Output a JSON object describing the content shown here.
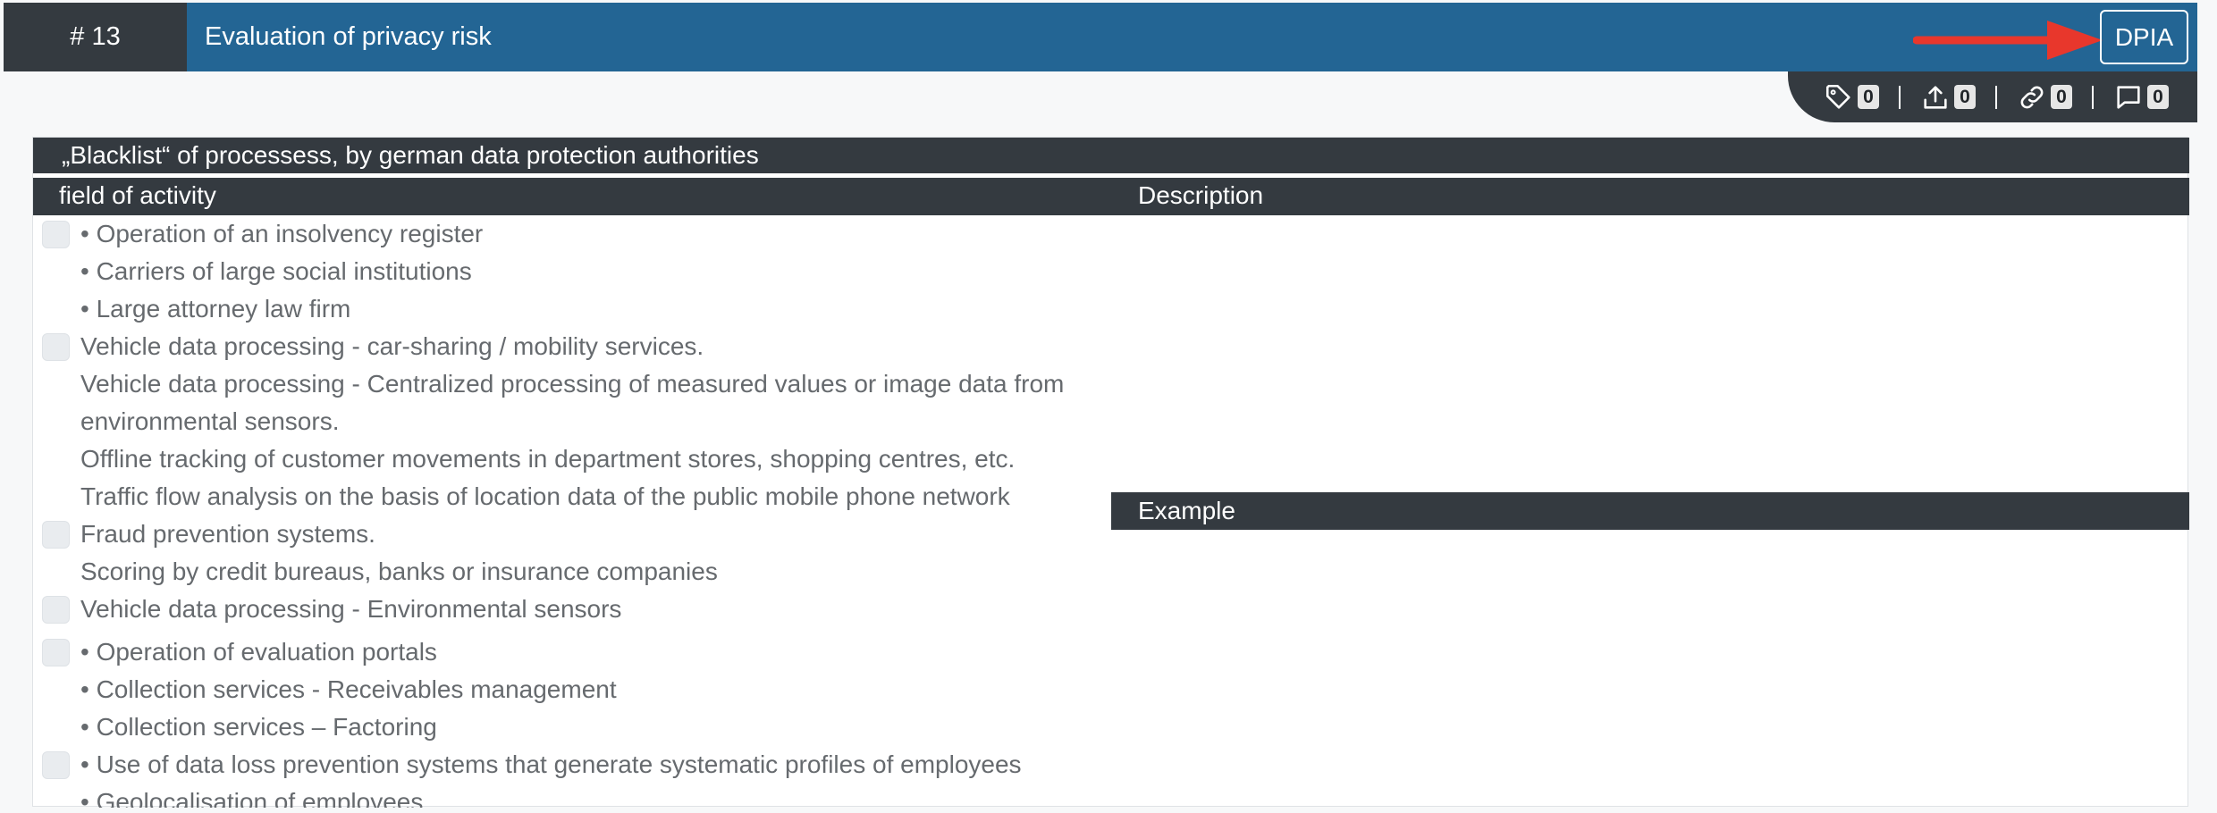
{
  "header": {
    "number": "# 13",
    "title": "Evaluation of privacy risk",
    "dpia_button": "DPIA"
  },
  "counters": [
    {
      "icon": "tag-icon",
      "count": "0"
    },
    {
      "icon": "upload-icon",
      "count": "0"
    },
    {
      "icon": "link-icon",
      "count": "0"
    },
    {
      "icon": "comment-icon",
      "count": "0"
    }
  ],
  "table": {
    "title": "„Blacklist“ of processess, by german data protection authorities",
    "col_field": "field of activity",
    "col_description": "Description",
    "example_label": "Example",
    "groups": [
      {
        "lines": [
          "• Operation of an insolvency register",
          "• Carriers of large social institutions",
          "• Large attorney law firm"
        ]
      },
      {
        "lines": [
          "Vehicle data processing - car-sharing / mobility services.",
          "Vehicle data processing - Centralized processing of measured values or image data from environmental sensors.",
          "Offline tracking of customer movements in department stores, shopping centres, etc.",
          "Traffic flow analysis on the basis of location data of the public mobile phone network"
        ]
      },
      {
        "lines": [
          "Fraud prevention systems.",
          "Scoring by credit bureaus, banks or insurance companies"
        ]
      },
      {
        "lines": [
          "Vehicle data processing - Environmental sensors"
        ]
      },
      {
        "lines": [
          "• Operation of evaluation portals",
          "• Collection services - Receivables management",
          "• Collection services – Factoring"
        ]
      },
      {
        "lines": [
          "• Use of data loss prevention systems that generate systematic profiles of employees",
          "• Geolocalisation of employees"
        ]
      }
    ]
  },
  "colors": {
    "header_blue": "#236594",
    "dark": "#343a40",
    "annotation_arrow": "#e8372c"
  }
}
